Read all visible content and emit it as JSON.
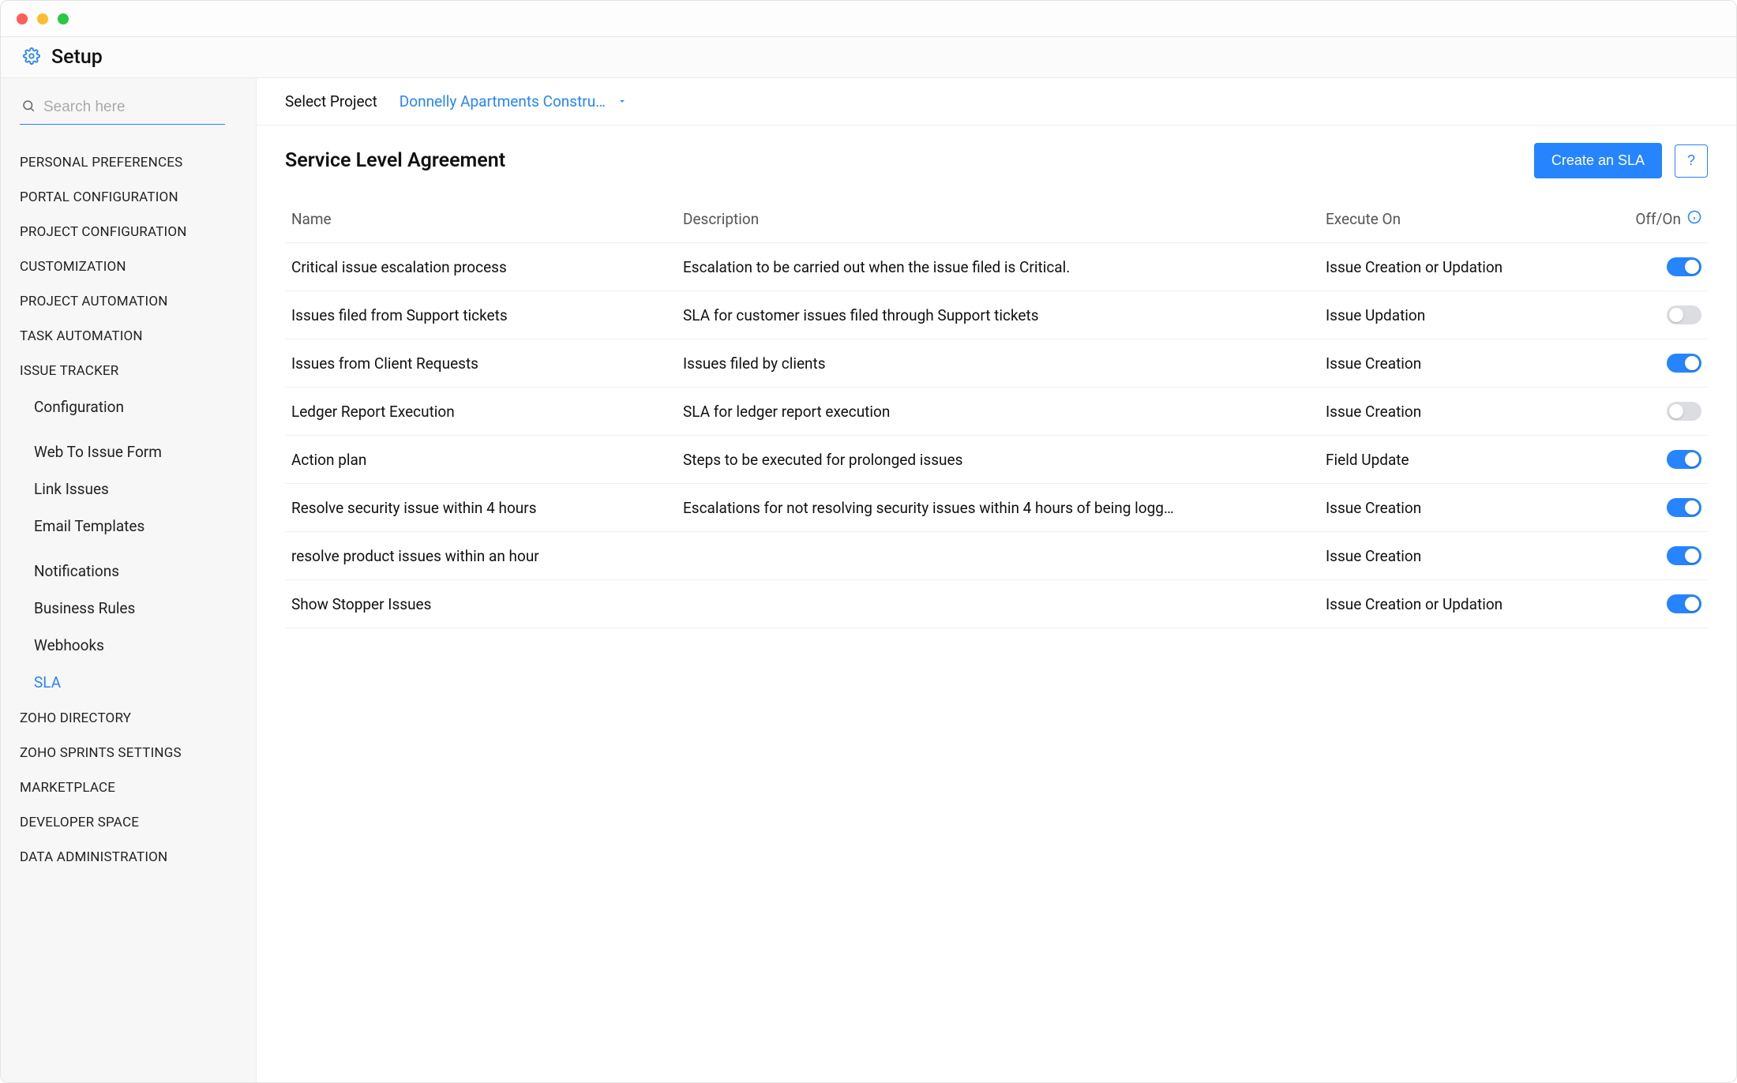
{
  "header": {
    "title": "Setup"
  },
  "sidebar": {
    "search_placeholder": "Search here",
    "sections": [
      {
        "label": "PERSONAL PREFERENCES",
        "items": []
      },
      {
        "label": "PORTAL CONFIGURATION",
        "items": []
      },
      {
        "label": "PROJECT CONFIGURATION",
        "items": []
      },
      {
        "label": "CUSTOMIZATION",
        "items": []
      },
      {
        "label": "PROJECT AUTOMATION",
        "items": []
      },
      {
        "label": "TASK AUTOMATION",
        "items": []
      },
      {
        "label": "ISSUE TRACKER",
        "items": [
          {
            "label": "Configuration",
            "selected": false
          },
          {
            "label": "Web To Issue Form",
            "selected": false
          },
          {
            "label": "Link Issues",
            "selected": false
          },
          {
            "label": "Email Templates",
            "selected": false
          },
          {
            "label": "Notifications",
            "selected": false
          },
          {
            "label": "Business Rules",
            "selected": false
          },
          {
            "label": "Webhooks",
            "selected": false
          },
          {
            "label": "SLA",
            "selected": true
          }
        ]
      },
      {
        "label": "ZOHO DIRECTORY",
        "items": []
      },
      {
        "label": "ZOHO SPRINTS SETTINGS",
        "items": []
      },
      {
        "label": "MARKETPLACE",
        "items": []
      },
      {
        "label": "DEVELOPER SPACE",
        "items": []
      },
      {
        "label": "DATA ADMINISTRATION",
        "items": []
      }
    ]
  },
  "project_bar": {
    "label": "Select Project",
    "selected_project": "Donnelly Apartments Constru…"
  },
  "page": {
    "title": "Service Level Agreement",
    "create_button": "Create an SLA",
    "help_button": "?"
  },
  "table": {
    "columns": {
      "name": "Name",
      "description": "Description",
      "execute_on": "Execute On",
      "off_on": "Off/On"
    },
    "rows": [
      {
        "name": "Critical issue escalation process",
        "description": "Escalation to be carried out when the issue filed is Critical.",
        "execute_on": "Issue Creation or Updation",
        "on": true
      },
      {
        "name": "Issues filed from Support tickets",
        "description": "SLA for customer issues filed through Support tickets",
        "execute_on": "Issue Updation",
        "on": false
      },
      {
        "name": "Issues from Client Requests",
        "description": "Issues filed by clients",
        "execute_on": "Issue Creation",
        "on": true
      },
      {
        "name": "Ledger Report Execution",
        "description": "SLA for ledger report execution",
        "execute_on": "Issue Creation",
        "on": false
      },
      {
        "name": "Action plan",
        "description": "Steps to be executed for prolonged issues",
        "execute_on": "Field Update",
        "on": true
      },
      {
        "name": "Resolve security issue within 4 hours",
        "description": "Escalations for not resolving security issues within 4 hours of being logg…",
        "execute_on": "Issue Creation",
        "on": true
      },
      {
        "name": "resolve product issues within an hour",
        "description": "",
        "execute_on": "Issue Creation",
        "on": true
      },
      {
        "name": "Show Stopper Issues",
        "description": "",
        "execute_on": "Issue Creation or Updation",
        "on": true
      }
    ]
  }
}
